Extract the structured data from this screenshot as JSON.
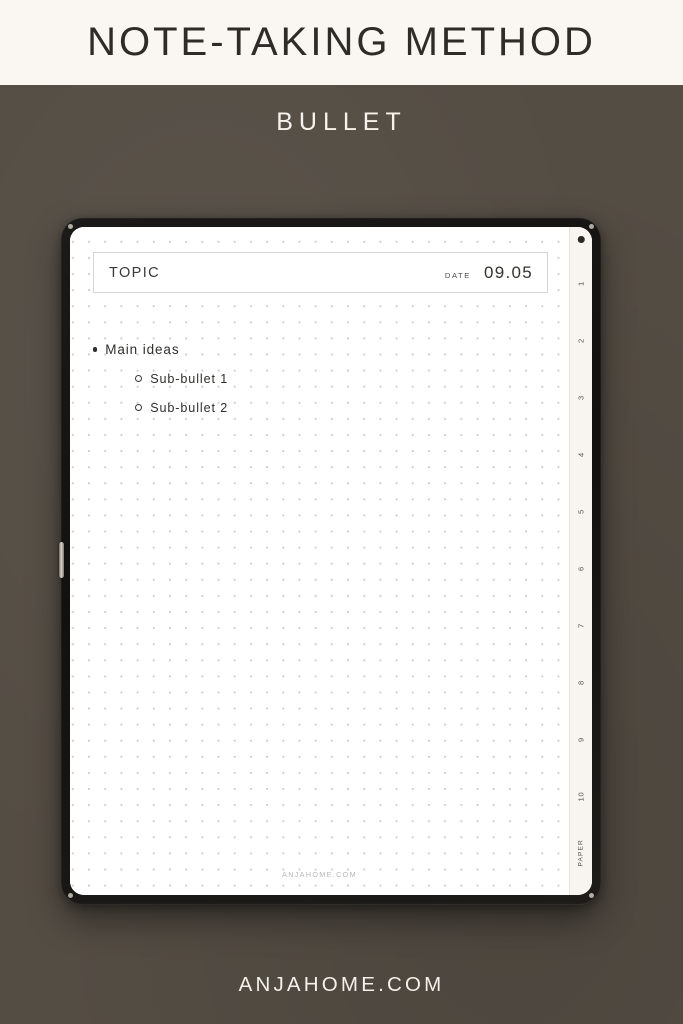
{
  "header": {
    "title": "NOTE-TAKING METHOD",
    "subtitle": "BULLET"
  },
  "colors": {
    "band_background": "#faf6f1",
    "page_background": "#544d44",
    "text_dark": "#2e2c28",
    "text_light": "#f6f2ec",
    "tablet_bezel": "#151311",
    "rail_background": "#f8f5f0"
  },
  "tablet": {
    "page": {
      "topic_label": "TOPIC",
      "date_label": "DATE",
      "date_value": "09.05",
      "notes": [
        {
          "marker": "filled-bullet",
          "level": 0,
          "text": "Main ideas"
        },
        {
          "marker": "hollow-bullet",
          "level": 2,
          "text": "Sub-bullet 1"
        },
        {
          "marker": "hollow-bullet",
          "level": 2,
          "text": "Sub-bullet 2"
        }
      ],
      "watermark": "ANJAHOME.COM"
    },
    "tab_rail": {
      "items": [
        "1",
        "2",
        "3",
        "4",
        "5",
        "6",
        "7",
        "8",
        "9",
        "10",
        "PAPER"
      ]
    }
  },
  "footer": {
    "brand": "ANJAHOME.COM"
  }
}
